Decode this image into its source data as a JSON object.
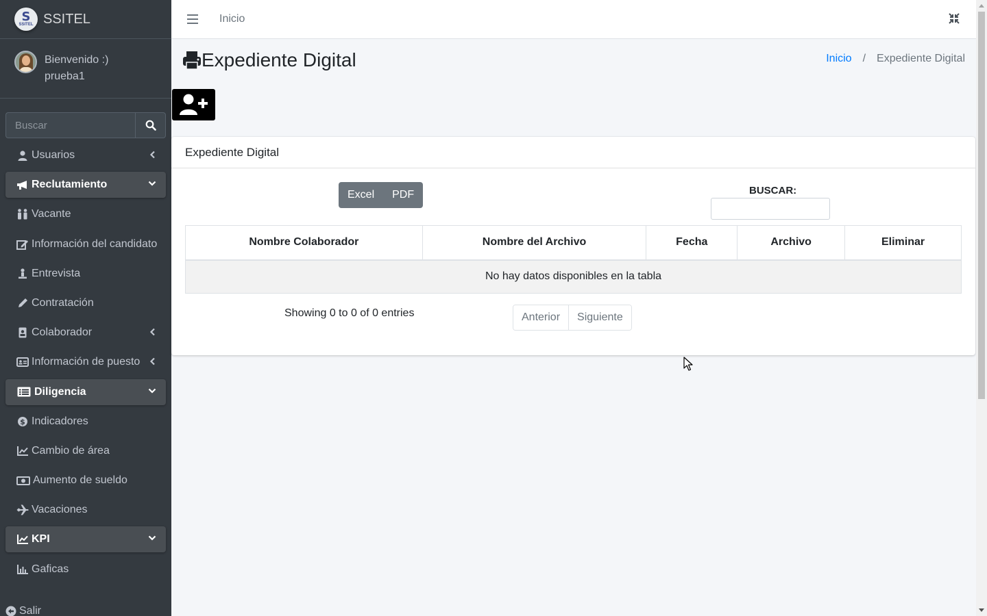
{
  "brand": {
    "logo_letter": "S",
    "logo_sub": "SSITEL",
    "name": "SSITEL"
  },
  "user": {
    "greeting": "Bienvenido :)",
    "username": "prueba1"
  },
  "sidebar_search": {
    "placeholder": "Buscar"
  },
  "nav": {
    "usuarios": "Usuarios",
    "reclutamiento": "Reclutamiento",
    "vacante": "Vacante",
    "info_candidato": "Información del candidato",
    "entrevista": "Entrevista",
    "contratacion": "Contratación",
    "colaborador": "Colaborador",
    "info_puesto": "Información de puesto",
    "diligencia": "Diligencia",
    "indicadores": "Indicadores",
    "cambio_area": "Cambio de área",
    "aumento_sueldo": "Aumento de sueldo",
    "vacaciones": "Vacaciones",
    "kpi": "KPI",
    "graficas": "Gaficas",
    "salir": "Salir"
  },
  "topbar": {
    "home_link": "Inicio"
  },
  "page": {
    "title": "Expediente Digital"
  },
  "breadcrumb": {
    "home": "Inicio",
    "separator": "/",
    "current": "Expediente Digital"
  },
  "card": {
    "header": "Expediente Digital",
    "export": {
      "excel": "Excel",
      "pdf": "PDF"
    },
    "search_label": "BUSCAR:",
    "table": {
      "headers": {
        "colaborador": "Nombre Colaborador",
        "archivo_nombre": "Nombre del Archivo",
        "fecha": "Fecha",
        "archivo": "Archivo",
        "eliminar": "Eliminar"
      },
      "empty_message": "No hay datos disponibles en la tabla"
    },
    "info": "Showing 0 to 0 of 0 entries",
    "pager": {
      "prev": "Anterior",
      "next": "Siguiente"
    }
  },
  "colors": {
    "sidebar_bg": "#343a40",
    "accent_link": "#007bff",
    "export_btn": "#6c757d",
    "add_btn": "#000000"
  }
}
